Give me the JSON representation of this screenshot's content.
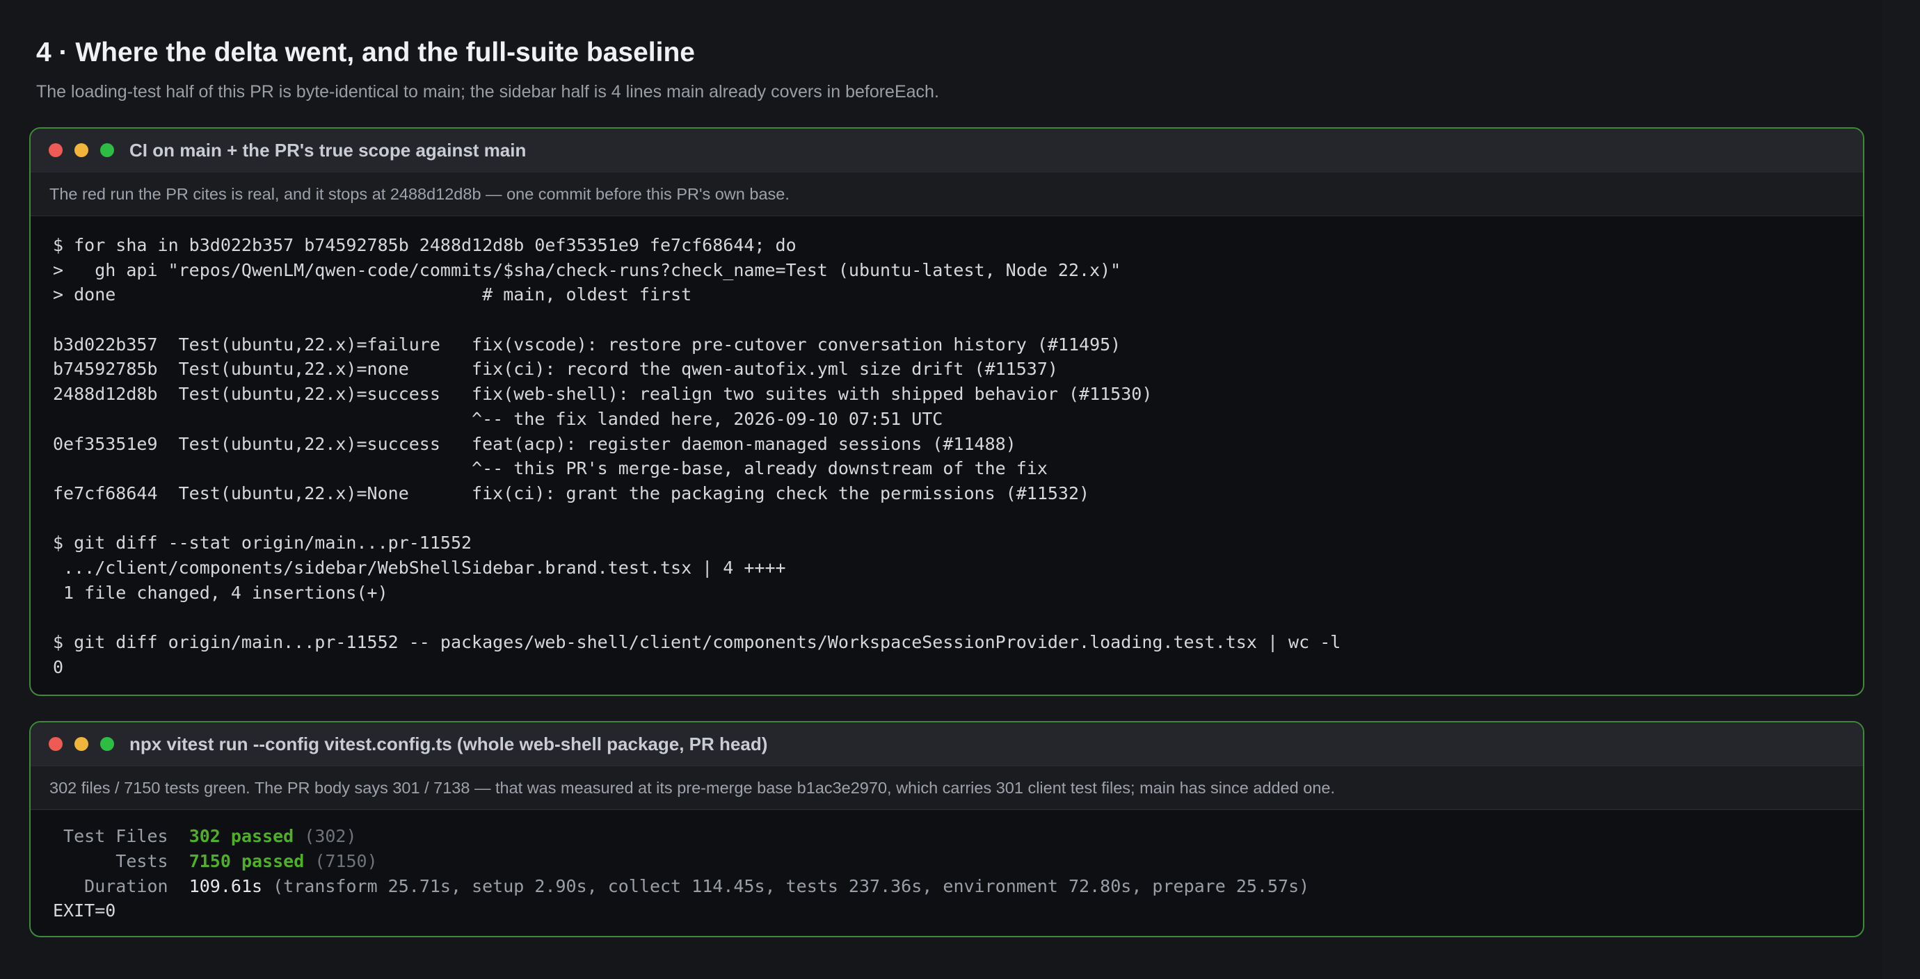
{
  "section": {
    "title": "4 · Where the delta went, and the full-suite baseline",
    "subtitle": "The loading-test half of this PR is byte-identical to main; the sidebar half is 4 lines main already covers in beforeEach."
  },
  "ci_window": {
    "title": "CI on main + the PR's true scope against main",
    "caption": "The red run the PR cites is real, and it stops at 2488d12d8b — one commit before this PR's own base.",
    "lines": [
      "$ for sha in b3d022b357 b74592785b 2488d12d8b 0ef35351e9 fe7cf68644; do",
      ">   gh api \"repos/QwenLM/qwen-code/commits/$sha/check-runs?check_name=Test (ubuntu-latest, Node 22.x)\"",
      "> done                                   # main, oldest first",
      "",
      "b3d022b357  Test(ubuntu,22.x)=failure   fix(vscode): restore pre-cutover conversation history (#11495)",
      "b74592785b  Test(ubuntu,22.x)=none      fix(ci): record the qwen-autofix.yml size drift (#11537)",
      "2488d12d8b  Test(ubuntu,22.x)=success   fix(web-shell): realign two suites with shipped behavior (#11530)",
      "                                        ^-- the fix landed here, 2026-09-10 07:51 UTC",
      "0ef35351e9  Test(ubuntu,22.x)=success   feat(acp): register daemon-managed sessions (#11488)",
      "                                        ^-- this PR's merge-base, already downstream of the fix",
      "fe7cf68644  Test(ubuntu,22.x)=None      fix(ci): grant the packaging check the permissions (#11532)",
      "",
      "$ git diff --stat origin/main...pr-11552",
      " .../client/components/sidebar/WebShellSidebar.brand.test.tsx | 4 ++++",
      " 1 file changed, 4 insertions(+)",
      "",
      "$ git diff origin/main...pr-11552 -- packages/web-shell/client/components/WorkspaceSessionProvider.loading.test.tsx | wc -l",
      "0"
    ]
  },
  "vitest_window": {
    "title": "npx vitest run --config vitest.config.ts (whole web-shell package, PR head)",
    "caption": "302 files / 7150 tests green. The PR body says 301 / 7138 — that was measured at its pre-merge base b1ac3e2970, which carries 301 client test files; main has since added one.",
    "test_files": {
      "label": " Test Files",
      "value": "302 passed",
      "total": "(302)"
    },
    "tests": {
      "label": "      Tests",
      "value": "7150 passed",
      "total": "(7150)"
    },
    "duration": {
      "label": "   Duration",
      "value": "109.61s",
      "detail": "(transform 25.71s, setup 2.90s, collect 114.45s, tests 237.36s, environment 72.80s, prepare 25.57s)"
    },
    "exit": "EXIT=0"
  },
  "colors": {
    "background": "#151619",
    "window_border": "#3e8a3a",
    "pass_green": "#4fae2a",
    "dot_red": "#ee5a54",
    "dot_yellow": "#f0b53a",
    "dot_green": "#2dbd45"
  }
}
